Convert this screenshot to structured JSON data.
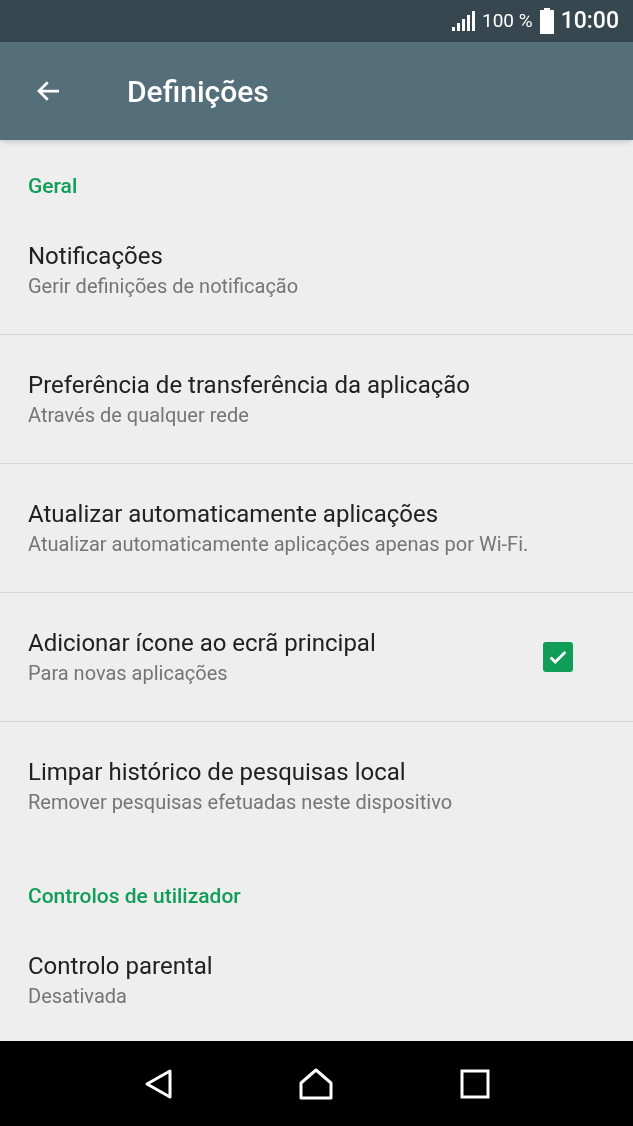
{
  "status_bar": {
    "battery_text": "100 %",
    "time": "10:00"
  },
  "toolbar": {
    "title": "Definições"
  },
  "sections": [
    {
      "header": "Geral",
      "items": [
        {
          "title": "Notificações",
          "subtitle": "Gerir definições de notificação",
          "kind": "plain",
          "divider": true
        },
        {
          "title": "Preferência de transferência da aplicação",
          "subtitle": "Através de qualquer rede",
          "kind": "plain",
          "divider": true
        },
        {
          "title": "Atualizar automaticamente aplicações",
          "subtitle": "Atualizar automaticamente aplicações apenas por Wi-Fi.",
          "kind": "plain",
          "divider": true
        },
        {
          "title": "Adicionar ícone ao ecrã principal",
          "subtitle": "Para novas aplicações",
          "kind": "checkbox",
          "checked": true,
          "divider": true
        },
        {
          "title": "Limpar histórico de pesquisas local",
          "subtitle": "Remover pesquisas efetuadas neste dispositivo",
          "kind": "plain",
          "divider": false
        }
      ]
    },
    {
      "header": "Controlos de utilizador",
      "items": [
        {
          "title": "Controlo parental",
          "subtitle": "Desativada",
          "kind": "plain",
          "divider": false
        }
      ]
    }
  ]
}
